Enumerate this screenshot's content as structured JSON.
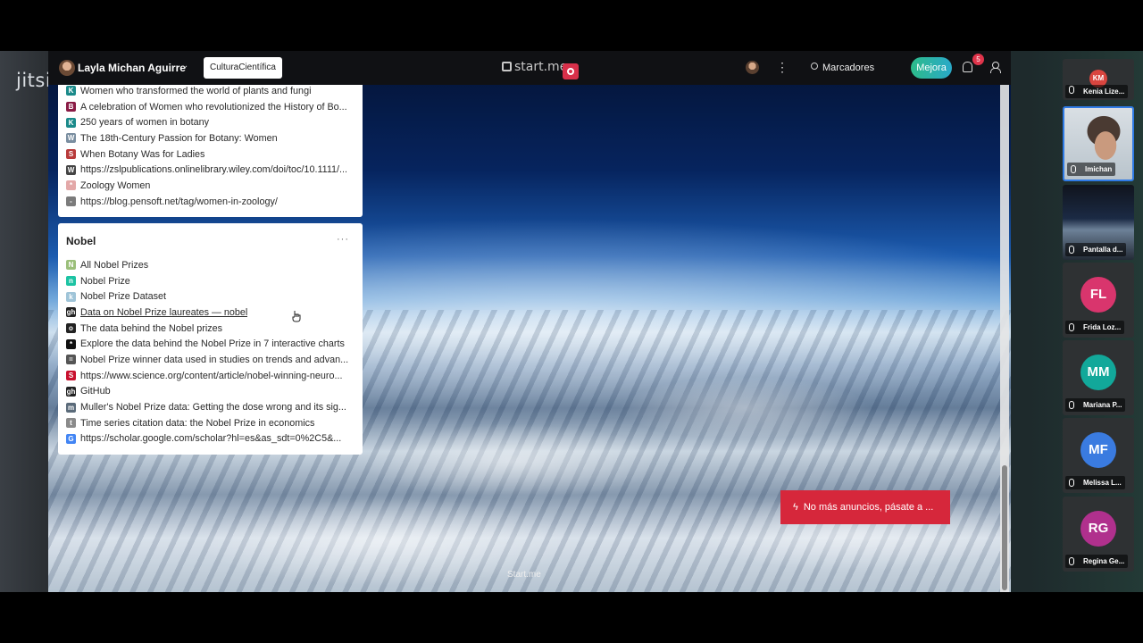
{
  "app": {
    "jitsi_logo": "jitsi"
  },
  "topbar": {
    "user_name": "Layla Michan Aguirre",
    "page_button": "CulturaCientífica",
    "logo": "start.me",
    "search_label": "Marcadores",
    "upgrade_label": "Mejora",
    "notification_count": "5"
  },
  "widget_top": {
    "items": [
      {
        "label": "Women who transformed the world of plants and fungi",
        "icon": "K",
        "color": "#1b8a8a"
      },
      {
        "label": "A celebration of Women who revolutionized the History of Bo...",
        "icon": "B",
        "color": "#8a1b45"
      },
      {
        "label": "250 years of women in botany",
        "icon": "K",
        "color": "#1b8a8a"
      },
      {
        "label": "The 18th-Century Passion for Botany: Women",
        "icon": "W",
        "color": "#7a8ea0"
      },
      {
        "label": "When Botany Was for Ladies",
        "icon": "S",
        "color": "#b83a3a"
      },
      {
        "label": "https://zslpublications.onlinelibrary.wiley.com/doi/toc/10.1111/...",
        "icon": "W",
        "color": "#444444"
      },
      {
        "label": "Zoology Women",
        "icon": "*",
        "color": "#e3a8a8"
      },
      {
        "label": "https://blog.pensoft.net/tag/women-in-zoology/",
        "icon": "-",
        "color": "#7b7b7b"
      }
    ]
  },
  "widget_nobel": {
    "title": "Nobel",
    "menu": "···",
    "items": [
      {
        "label": "All Nobel Prizes",
        "icon": "N",
        "color": "#9bbf7a"
      },
      {
        "label": "Nobel Prize",
        "icon": "n",
        "color": "#1cc3a3"
      },
      {
        "label": "Nobel Prize Dataset",
        "icon": "k",
        "color": "#9fc4d8"
      },
      {
        "label": "Data on Nobel Prize laureates — nobel",
        "icon": "gh",
        "color": "#222222"
      },
      {
        "label": "The data behind the Nobel prizes",
        "icon": "o",
        "color": "#222222"
      },
      {
        "label": "Explore the data behind the Nobel Prize in 7 interactive charts",
        "icon": "*",
        "color": "#111111"
      },
      {
        "label": "Nobel Prize winner data used in studies on trends and advan...",
        "icon": "=",
        "color": "#555555"
      },
      {
        "label": "https://www.science.org/content/article/nobel-winning-neuro...",
        "icon": "S",
        "color": "#c8102e"
      },
      {
        "label": "GitHub",
        "icon": "gh",
        "color": "#222222"
      },
      {
        "label": "Muller's Nobel Prize data: Getting the dose wrong and its sig...",
        "icon": "m",
        "color": "#5b6b7a"
      },
      {
        "label": "Time series citation data: the Nobel Prize in economics",
        "icon": "t",
        "color": "#8a8a8a"
      },
      {
        "label": "https://scholar.google.com/scholar?hl=es&as_sdt=0%2C5&...",
        "icon": "G",
        "color": "#4285f4"
      }
    ]
  },
  "ad_button": "No más anuncios, pásate a ...",
  "footer": "Start.me",
  "participants": [
    {
      "initials": "KM",
      "name": "Kenia Lize...",
      "color": "#d9453f"
    },
    {
      "initials": "",
      "name": "lmichan",
      "color": ""
    },
    {
      "initials": "",
      "name": "Pantalla d...",
      "color": ""
    },
    {
      "initials": "FL",
      "name": "Frida Loz...",
      "color": "#d9356d"
    },
    {
      "initials": "MM",
      "name": "Mariana P...",
      "color": "#12a89a"
    },
    {
      "initials": "MF",
      "name": "Melissa L...",
      "color": "#3a7be0"
    },
    {
      "initials": "RG",
      "name": "Regina Ge...",
      "color": "#b0308d"
    }
  ]
}
